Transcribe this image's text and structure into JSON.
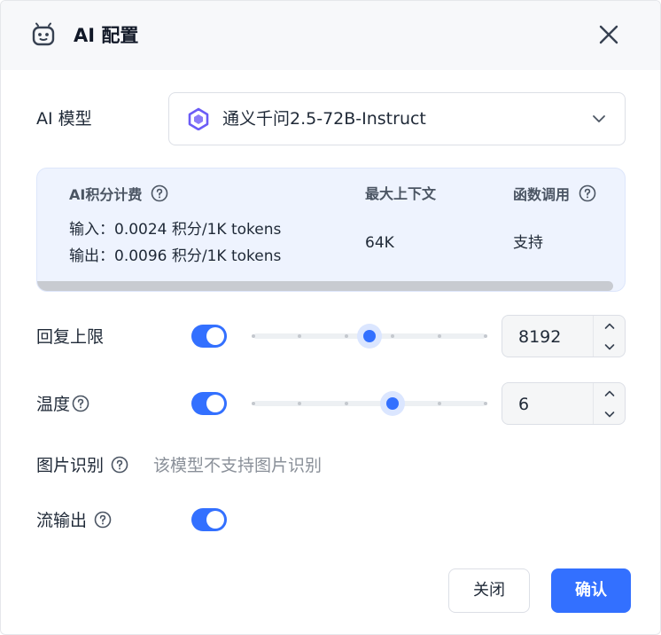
{
  "dialog": {
    "title": "AI 配置",
    "logo_icon": "robot-logo-icon",
    "close_icon": "close-icon"
  },
  "model": {
    "label": "AI 模型",
    "selected": "通义千问2.5-72B-Instruct",
    "model_icon": "qwen-model-icon",
    "dropdown_icon": "chevron-down-icon"
  },
  "info": {
    "points_header": "AI积分计费",
    "context_header": "最大上下文",
    "function_header": "函数调用",
    "input_price": "输入：0.0024 积分/1K tokens",
    "output_price": "输出：0.0096 积分/1K tokens",
    "context_value": "64K",
    "function_value": "支持"
  },
  "reply_limit": {
    "label": "回复上限",
    "enabled": true,
    "value": "8192",
    "slider_fraction": 0.5
  },
  "temperature": {
    "label": "温度",
    "enabled": true,
    "value": "6",
    "slider_fraction": 0.6
  },
  "image_recognition": {
    "label": "图片识别",
    "note": "该模型不支持图片识别"
  },
  "stream_output": {
    "label": "流输出",
    "enabled": true
  },
  "footer": {
    "cancel_label": "关闭",
    "confirm_label": "确认"
  },
  "colors": {
    "accent": "#3370ff",
    "card_bg": "#eef3fe"
  }
}
